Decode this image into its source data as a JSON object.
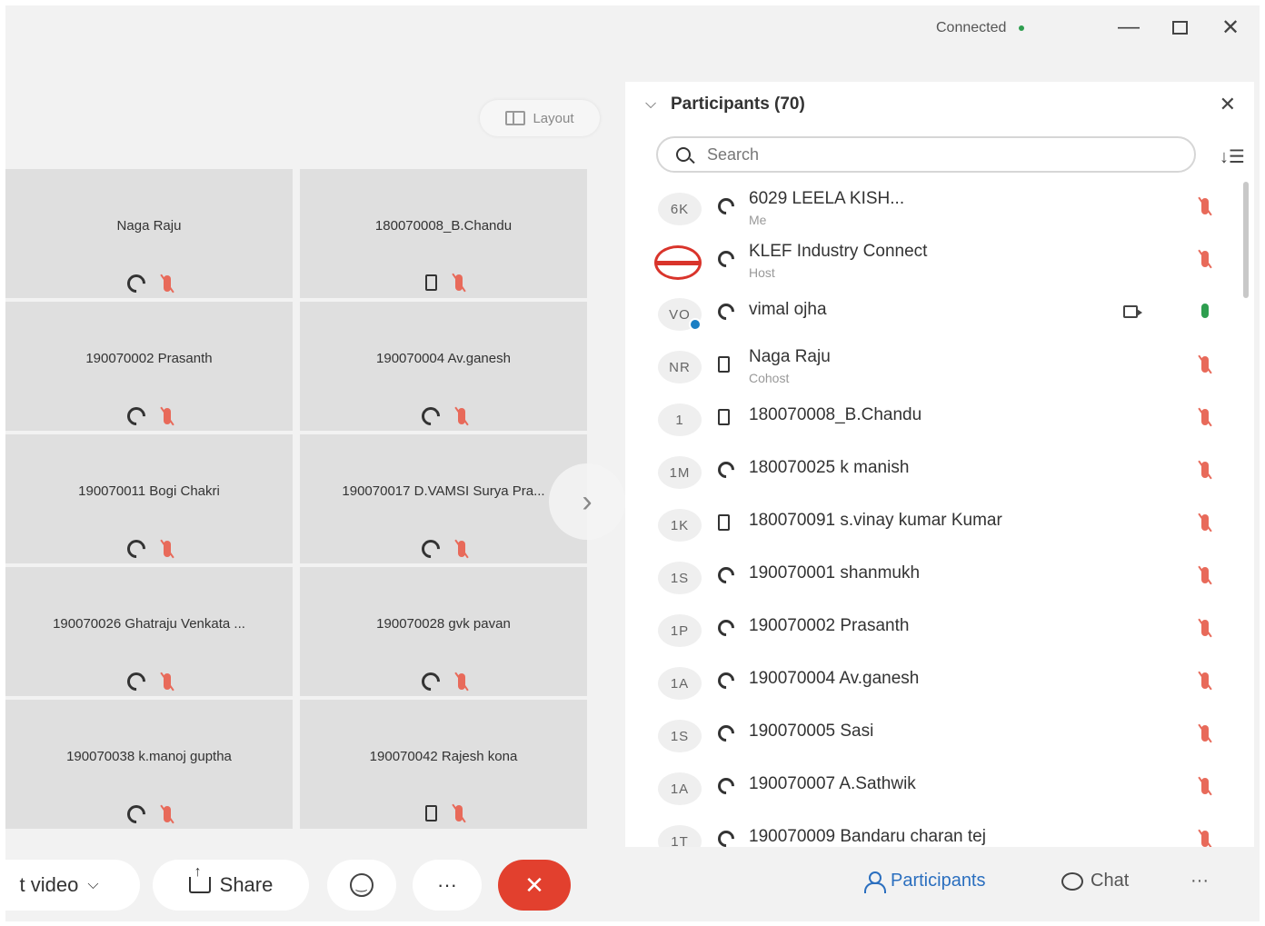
{
  "titlebar": {
    "status": "Connected",
    "status_color": "#2e9e4f",
    "minimize_icon": "minimize-icon",
    "maximize_icon": "maximize-icon",
    "close_icon": "close-icon"
  },
  "layout_button": {
    "label": "Layout"
  },
  "video_tiles": [
    {
      "name": "Naga Raju",
      "audio": "computer-audio",
      "muted": true
    },
    {
      "name": "180070008_B.Chandu",
      "audio": "phone",
      "muted": true
    },
    {
      "name": "190070002 Prasanth",
      "audio": "computer-audio",
      "muted": true
    },
    {
      "name": "190070004 Av.ganesh",
      "audio": "computer-audio",
      "muted": true
    },
    {
      "name": "190070011 Bogi Chakri",
      "audio": "computer-audio",
      "muted": true
    },
    {
      "name": "190070017 D.VAMSI Surya Pra...",
      "audio": "computer-audio",
      "muted": true
    },
    {
      "name": "190070026 Ghatraju Venkata ...",
      "audio": "computer-audio",
      "muted": true
    },
    {
      "name": "190070028 gvk pavan",
      "audio": "computer-audio",
      "muted": true
    },
    {
      "name": "190070038 k.manoj guptha",
      "audio": "computer-audio",
      "muted": true
    },
    {
      "name": "190070042 Rajesh kona",
      "audio": "phone",
      "muted": true
    }
  ],
  "participants_panel": {
    "title": "Participants (70)",
    "search_placeholder": "Search",
    "participants": [
      {
        "initials": "6K",
        "audio": "computer-audio",
        "name": "6029 LEELA KISH...",
        "role": "Me",
        "muted": true
      },
      {
        "initials": "",
        "logo": true,
        "audio": "computer-audio",
        "name": "KLEF Industry Connect",
        "role": "Host",
        "muted": true
      },
      {
        "initials": "VO",
        "badge": true,
        "audio": "computer-audio",
        "name": "vimal ojha",
        "role": "",
        "video": true,
        "muted": false
      },
      {
        "initials": "NR",
        "audio": "phone",
        "name": "Naga Raju",
        "role": "Cohost",
        "muted": true
      },
      {
        "initials": "1",
        "audio": "phone",
        "name": "180070008_B.Chandu",
        "role": "",
        "muted": true
      },
      {
        "initials": "1M",
        "audio": "computer-audio",
        "name": "180070025 k manish",
        "role": "",
        "muted": true
      },
      {
        "initials": "1K",
        "audio": "phone",
        "name": "180070091 s.vinay kumar Kumar",
        "role": "",
        "muted": true
      },
      {
        "initials": "1S",
        "audio": "computer-audio",
        "name": "190070001 shanmukh",
        "role": "",
        "muted": true
      },
      {
        "initials": "1P",
        "audio": "computer-audio",
        "name": "190070002 Prasanth",
        "role": "",
        "muted": true
      },
      {
        "initials": "1A",
        "audio": "computer-audio",
        "name": "190070004 Av.ganesh",
        "role": "",
        "muted": true
      },
      {
        "initials": "1S",
        "audio": "computer-audio",
        "name": "190070005 Sasi",
        "role": "",
        "muted": true
      },
      {
        "initials": "1A",
        "audio": "computer-audio",
        "name": "190070007 A.Sathwik",
        "role": "",
        "muted": true
      },
      {
        "initials": "1T",
        "audio": "computer-audio",
        "name": "190070009 Bandaru charan tej",
        "role": "",
        "muted": true
      }
    ]
  },
  "bottom_bar": {
    "video_label": "t video",
    "share_label": "Share",
    "more_label": "···",
    "end_label": "✕",
    "participants_label": "Participants",
    "chat_label": "Chat",
    "overflow_label": "···"
  },
  "colors": {
    "end_button": "#e2402e",
    "muted_mic": "#e86a5a",
    "active_mic": "#2e9e4f",
    "accent": "#2b6fbf"
  }
}
